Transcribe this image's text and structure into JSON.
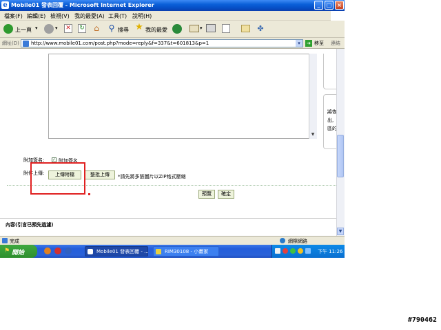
{
  "window": {
    "title": "Mobile01 發表回覆 - Microsoft Internet Explorer",
    "controls": [
      "_",
      "□",
      "×"
    ]
  },
  "menu": [
    "檔案(F)",
    "編輯(E)",
    "檢視(V)",
    "我的最愛(A)",
    "工具(T)",
    "說明(H)"
  ],
  "toolbar": {
    "back_label": "上一頁",
    "search_label": "搜尋",
    "favorites_label": "我的最愛"
  },
  "address": {
    "label": "網址(D)",
    "url": "http://www.mobile01.com/post.php?mode=reply&f=337&t=601813&p=1",
    "go_label": "移至",
    "links_label": "連結"
  },
  "form": {
    "signature_label": "附加簽名:",
    "signature_checkbox_label": "附加簽名",
    "signature_checked": true,
    "attach_label": "附件上傳:",
    "upload_button": "上傳附檔",
    "batch_upload_button": "整批上傳",
    "upload_hint": "*請先將多張圖片以ZIP格式壓縮",
    "preview_button": "預覽",
    "submit_button": "確定",
    "quote_header": "內容(引言已預先過濾)"
  },
  "side_panel": {
    "lines": [
      "將恢",
      "出,",
      "區的"
    ]
  },
  "status": {
    "left": "完成",
    "zone": "網際網路"
  },
  "taskbar": {
    "start_label": "開始",
    "tasks": [
      {
        "label": "Mobile01 發表回覆 - ...",
        "active": true
      },
      {
        "label": "RIM30108 - 小畫家",
        "active": false
      }
    ],
    "clock": "下午 11:26"
  },
  "image_id_text": "#790462",
  "colors": {
    "highlight_box": "#e02020",
    "taskbar_blue": "#245edb",
    "start_green": "#3a9e3a"
  }
}
